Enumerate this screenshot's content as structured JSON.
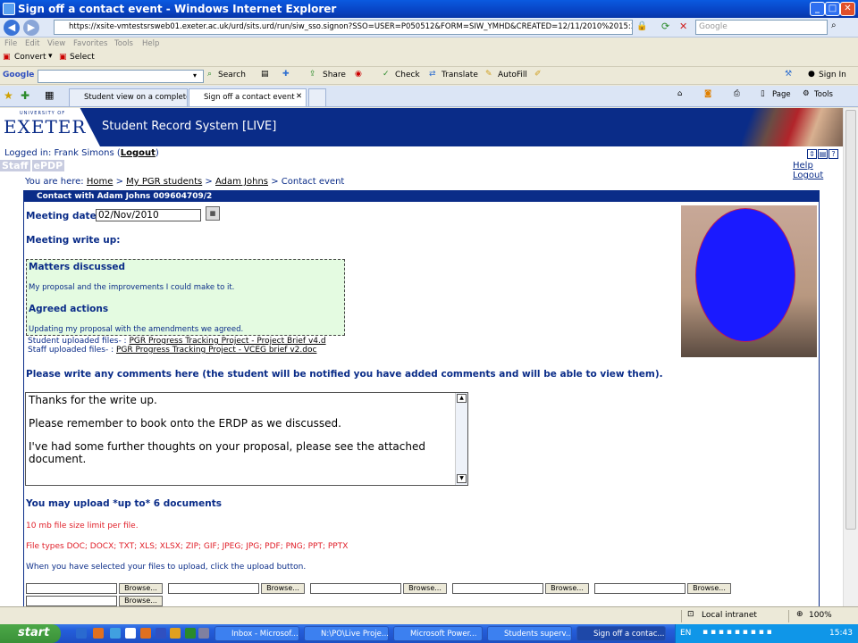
{
  "window": {
    "title": "Sign off a contact event - Windows Internet Explorer"
  },
  "addressbar": {
    "url": "https://xsite-vmtestsrsweb01.exeter.ac.uk/urd/sits.urd/run/siw_sso.signon?SSO=USER=P050512&FORM=SIW_YMHD&CREATED=12/11/2010%2015:32&EXPIRES=168&1",
    "search_placeholder": "Google"
  },
  "menubar": [
    "File",
    "Edit",
    "View",
    "Favorites",
    "Tools",
    "Help"
  ],
  "convertbar": {
    "convert": "Convert",
    "select": "Select"
  },
  "googlebar": {
    "logo": "Google",
    "items": [
      "Search",
      "Share",
      "Check",
      "Translate",
      "AutoFill"
    ],
    "signin": "Sign In"
  },
  "tabs": [
    {
      "label": "Student view on a completed..."
    },
    {
      "label": "Sign off a contact event"
    }
  ],
  "command": {
    "page": "Page",
    "tools": "Tools"
  },
  "site": {
    "logo_small": "UNIVERSITY OF",
    "logo": "EXETER",
    "system_title": "Student Record System [LIVE]",
    "logged_in_prefix": "Logged in: Frank Simons (",
    "logout_link": "Logout",
    "logged_in_suffix": ")",
    "tab_staff": "Staff",
    "tab_epdp": "ePDP",
    "help": "Help",
    "logout": "Logout"
  },
  "breadcrumb": {
    "prefix": "You are here:",
    "items": [
      "Home",
      "My PGR students",
      "Adam Johns"
    ],
    "current": "Contact event",
    "sep": ">"
  },
  "contact": {
    "header": "Contact with Adam Johns 009604709/2",
    "meeting_date_label": "Meeting date",
    "meeting_date": "02/Nov/2010",
    "writeup_label": "Meeting write up:",
    "matters_heading": "Matters discussed",
    "matters_text": "My proposal and the improvements I could make to it.",
    "actions_heading": "Agreed actions",
    "actions_text": "Updating my proposal with the amendments we agreed.",
    "student_files_label": "Student uploaded files- :",
    "student_file": "PGR Progress Tracking Project - Project Brief v4.d",
    "staff_files_label": "Staff uploaded files- :",
    "staff_file": "PGR Progress Tracking Project - VCEG brief v2.doc",
    "comment_prompt": "Please write any comments here (the student will be notified you have added comments and will be able to view them).",
    "comment_lines": [
      "Thanks for the write up.",
      "Please remember to book onto the ERDP as we discussed.",
      "I've had some further thoughts on your proposal, please see the attached document."
    ],
    "upload_title": "You may upload *up to* 6 documents",
    "size_limit": "10 mb file size limit per file.",
    "file_types": "File types DOC; DOCX; TXT; XLS; XLSX; ZIP; GIF; JPEG; JPG; PDF; PNG; PPT; PPTX",
    "upload_instruction": "When you have selected your files to upload, click the upload button.",
    "browse_label": "Browse..."
  },
  "statusbar": {
    "zone": "Local intranet",
    "zoom": "100%"
  },
  "taskbar": {
    "start": "start",
    "tasks": [
      "Inbox - Microsof...",
      "N:\\PO\\Live Proje...",
      "Microsoft Power...",
      "Students superv...",
      "Sign off a contac..."
    ],
    "lang": "EN",
    "time": "15:43"
  },
  "colors": {
    "brand": "#0a2c88",
    "note_bg": "#e4fbe1",
    "warning": "#e0202a"
  }
}
